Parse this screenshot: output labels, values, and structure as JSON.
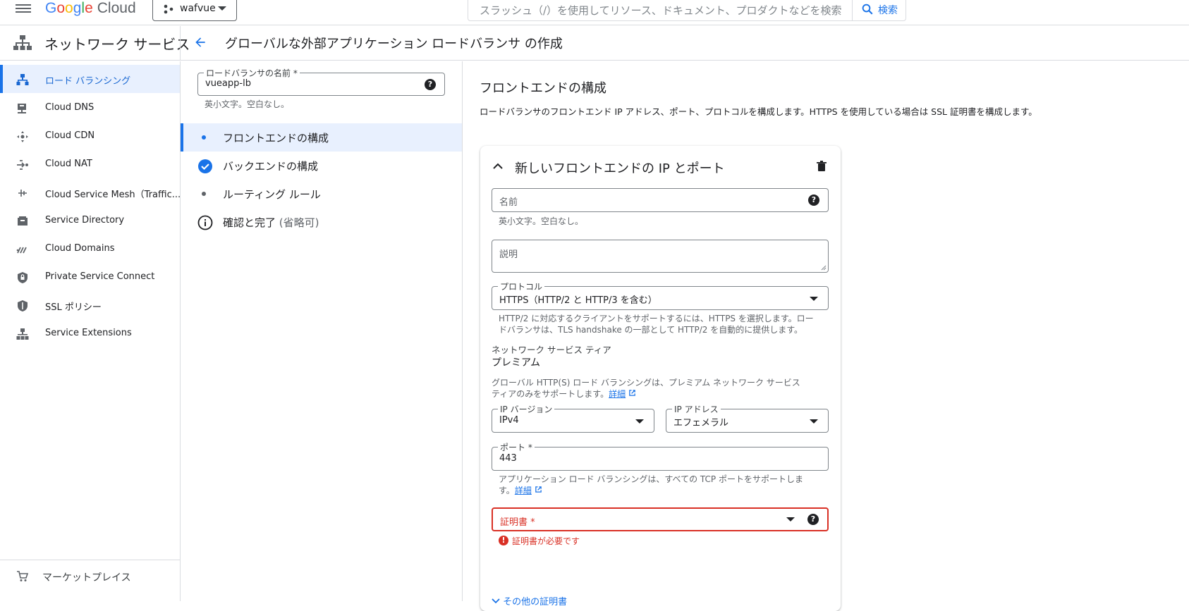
{
  "header": {
    "logo_text": "Google Cloud",
    "project": "wafvue",
    "search_placeholder": "スラッシュ（/）を使用してリソース、ドキュメント、プロダクトなどを検索",
    "search_button": "検索"
  },
  "subheader": {
    "service_title": "ネットワーク サービス",
    "page_title": "グローバルな外部アプリケーション ロードバランサ の作成"
  },
  "sidebar": {
    "items": [
      {
        "label": "ロード バランシング",
        "icon": "load-balancing-icon"
      },
      {
        "label": "Cloud DNS",
        "icon": "dns-icon"
      },
      {
        "label": "Cloud CDN",
        "icon": "cdn-icon"
      },
      {
        "label": "Cloud NAT",
        "icon": "nat-icon"
      },
      {
        "label": "Cloud Service Mesh（Traffic...",
        "icon": "service-mesh-icon"
      },
      {
        "label": "Service Directory",
        "icon": "service-directory-icon"
      },
      {
        "label": "Cloud Domains",
        "icon": "domains-icon"
      },
      {
        "label": "Private Service Connect",
        "icon": "private-service-connect-icon"
      },
      {
        "label": "SSL ポリシー",
        "icon": "ssl-policy-icon"
      },
      {
        "label": "Service Extensions",
        "icon": "service-extensions-icon"
      }
    ],
    "marketplace": "マーケットプレイス"
  },
  "stepper": {
    "lb_name_label": "ロードバランサの名前 *",
    "lb_name_value": "vueapp-lb",
    "lb_name_hint": "英小文字。空白なし。",
    "steps": [
      {
        "label": "フロントエンドの構成",
        "state": "active"
      },
      {
        "label": "バックエンドの構成",
        "state": "done"
      },
      {
        "label": "ルーティング ルール",
        "state": "pending"
      },
      {
        "label": "確認と完了",
        "optional": "(省略可)",
        "state": "info"
      }
    ]
  },
  "main": {
    "section_title": "フロントエンドの構成",
    "section_desc": "ロードバランサのフロントエンド IP アドレス、ポート、プロトコルを構成します。HTTPS を使用している場合は SSL 証明書を構成します。",
    "card_title": "新しいフロントエンドの IP とポート",
    "name_placeholder": "名前",
    "name_hint": "英小文字。空白なし。",
    "description_placeholder": "説明",
    "protocol_label": "プロトコル",
    "protocol_value": "HTTPS（HTTP/2 と HTTP/3 を含む）",
    "protocol_hint_1": "HTTP/2 に対応するクライアントをサポートするには、HTTPS を選択します。ロー",
    "protocol_hint_2": "ドバランサは、TLS handshake の一部として HTTP/2 を自動的に提供します。",
    "tier_label": "ネットワーク サービス ティア",
    "tier_value": "プレミアム",
    "tier_hint_1": "グローバル HTTP(S) ロード バランシングは、プレミアム ネットワーク サービス",
    "tier_hint_2": "ティアのみをサポートします。",
    "details_link": "詳細",
    "ip_version_label": "IP バージョン",
    "ip_version_value": "IPv4",
    "ip_address_label": "IP アドレス",
    "ip_address_value": "エフェメラル",
    "port_label": "ポート *",
    "port_value": "443",
    "port_hint_1": "アプリケーション ロード バランシングは、すべての TCP ポートをサポートしま",
    "port_hint_2": "す。",
    "cert_placeholder": "証明書 *",
    "cert_error": "証明書が必要です",
    "more_certs": "その他の証明書"
  },
  "colors": {
    "accent": "#1a73e8",
    "active_bg": "#e8f0fe",
    "error": "#d93025"
  }
}
